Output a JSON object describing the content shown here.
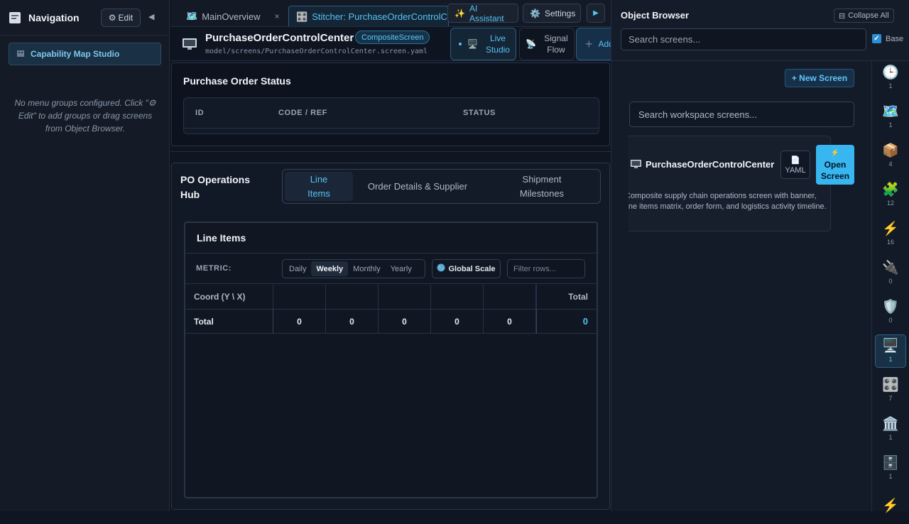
{
  "nav": {
    "title": "Navigation",
    "edit_label": "Edit",
    "collapse_glyph": "◀",
    "items": [
      {
        "label": "Capability Map Studio"
      }
    ],
    "empty_message": "No menu groups configured. Click \"⚙ Edit\" to add groups or drag screens from Object Browser."
  },
  "tabs": {
    "items": [
      {
        "label": "MainOverview",
        "close": "×"
      },
      {
        "label": "Stitcher: PurchaseOrderControlCenter"
      }
    ],
    "ai_assistant": "AI Assistant",
    "settings": "Settings",
    "run_glyph": "▶"
  },
  "screen": {
    "name": "PurchaseOrderControlCenter",
    "badge": "CompositeScreen",
    "path": "model/screens/PurchaseOrderControlCenter.screen.yaml",
    "live_studio": "Live Studio",
    "signal_flow": "Signal Flow",
    "add_draft": "Add Draft"
  },
  "po_status": {
    "title": "Purchase Order Status",
    "columns": [
      "ID",
      "CODE / REF",
      "STATUS"
    ]
  },
  "hub": {
    "title": "PO Operations Hub",
    "tabs": [
      {
        "label": "Line Items",
        "active": true
      },
      {
        "label": "Order Details & Supplier",
        "active": false
      },
      {
        "label": "Shipment Milestones",
        "active": false
      }
    ],
    "panel_title": "Line Items",
    "metric_label": "METRIC:",
    "periods": [
      {
        "label": "Daily",
        "active": false
      },
      {
        "label": "Weekly",
        "active": true
      },
      {
        "label": "Monthly",
        "active": false
      },
      {
        "label": "Yearly",
        "active": false
      }
    ],
    "global_scale": "Global Scale",
    "filter_placeholder": "Filter rows...",
    "grid": {
      "corner": "Coord (Y \\ X)",
      "total_header": "Total",
      "row_label": "Total",
      "values": [
        "0",
        "0",
        "0",
        "0",
        "0"
      ],
      "grand_total": "0"
    }
  },
  "object_browser": {
    "title": "Object Browser",
    "collapse_all": "Collapse All",
    "search_placeholder": "Search screens...",
    "base_label": "Base",
    "base_checked": true,
    "new_screen": "+ New Screen",
    "workspace_search_placeholder": "Search workspace screens...",
    "screen_card": {
      "name": "PurchaseOrderControlCenter",
      "yaml_label": "YAML",
      "open_label": "Open Screen",
      "description": "Composite supply chain operations screen with banner, line items matrix, order form, and logistics activity timeline."
    },
    "rail": [
      {
        "icon": "clock-icon",
        "glyph": "🕒",
        "count": "1"
      },
      {
        "icon": "map-icon",
        "glyph": "🗺️",
        "count": "1"
      },
      {
        "icon": "package-icon",
        "glyph": "📦",
        "count": "4"
      },
      {
        "icon": "puzzle-icon",
        "glyph": "🧩",
        "count": "12"
      },
      {
        "icon": "lightning-icon",
        "glyph": "⚡",
        "count": "16"
      },
      {
        "icon": "plug-icon",
        "glyph": "🔌",
        "count": "0"
      },
      {
        "icon": "shield-icon",
        "glyph": "🛡️",
        "count": "0"
      },
      {
        "icon": "monitor-icon",
        "glyph": "🖥️",
        "count": "1",
        "active": true
      },
      {
        "icon": "control-knobs-icon",
        "glyph": "🎛️",
        "count": "7"
      },
      {
        "icon": "building-icon",
        "glyph": "🏛️",
        "count": "1"
      },
      {
        "icon": "cabinet-icon",
        "glyph": "🗄️",
        "count": "1"
      },
      {
        "icon": "lightning-icon",
        "glyph": "⚡",
        "count": ""
      }
    ]
  },
  "colors": {
    "accent": "#38b6f0",
    "background": "#0f1521",
    "panel": "#141b28"
  }
}
